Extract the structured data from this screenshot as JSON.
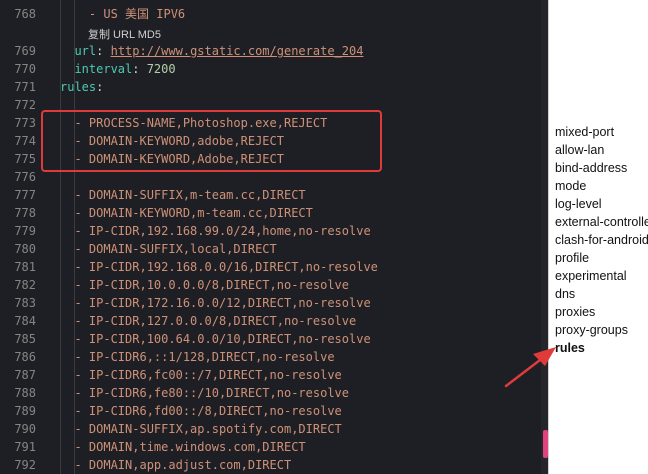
{
  "editor": {
    "tooltip": "复制 URL MD5",
    "lines": [
      {
        "num": "768",
        "indent": "    ",
        "tokens": [
          {
            "t": "- ",
            "c": "s"
          },
          {
            "t": "US 美国 IPV6",
            "c": "s"
          }
        ]
      },
      {
        "num": "",
        "tooltip": true
      },
      {
        "num": "769",
        "indent": "  ",
        "tokens": [
          {
            "t": "url",
            "c": "k"
          },
          {
            "t": ": ",
            "c": "p"
          },
          {
            "t": "http://www.gstatic.com/generate_204",
            "c": "u"
          }
        ]
      },
      {
        "num": "770",
        "indent": "  ",
        "tokens": [
          {
            "t": "interval",
            "c": "k"
          },
          {
            "t": ": ",
            "c": "p"
          },
          {
            "t": "7200",
            "c": "n"
          }
        ]
      },
      {
        "num": "771",
        "indent": "",
        "tokens": [
          {
            "t": "rules",
            "c": "k"
          },
          {
            "t": ":",
            "c": "p"
          }
        ]
      },
      {
        "num": "772",
        "indent": "",
        "tokens": []
      },
      {
        "num": "773",
        "indent": "  ",
        "tokens": [
          {
            "t": "- PROCESS-NAME,Photoshop.exe,REJECT",
            "c": "s"
          }
        ]
      },
      {
        "num": "774",
        "indent": "  ",
        "tokens": [
          {
            "t": "- DOMAIN-KEYWORD,adobe,REJECT",
            "c": "s"
          }
        ]
      },
      {
        "num": "775",
        "indent": "  ",
        "tokens": [
          {
            "t": "- DOMAIN-KEYWORD,Adobe,REJECT",
            "c": "s"
          }
        ]
      },
      {
        "num": "776",
        "indent": "",
        "tokens": []
      },
      {
        "num": "777",
        "indent": "  ",
        "tokens": [
          {
            "t": "- DOMAIN-SUFFIX,m-team.cc,DIRECT",
            "c": "s"
          }
        ]
      },
      {
        "num": "778",
        "indent": "  ",
        "tokens": [
          {
            "t": "- DOMAIN-KEYWORD,m-team.cc,DIRECT",
            "c": "s"
          }
        ]
      },
      {
        "num": "779",
        "indent": "  ",
        "tokens": [
          {
            "t": "- IP-CIDR,192.168.99.0/24,home,no-resolve",
            "c": "s"
          }
        ]
      },
      {
        "num": "780",
        "indent": "  ",
        "tokens": [
          {
            "t": "- DOMAIN-SUFFIX,local,DIRECT",
            "c": "s"
          }
        ]
      },
      {
        "num": "781",
        "indent": "  ",
        "tokens": [
          {
            "t": "- IP-CIDR,192.168.0.0/16,DIRECT,no-resolve",
            "c": "s"
          }
        ]
      },
      {
        "num": "782",
        "indent": "  ",
        "tokens": [
          {
            "t": "- IP-CIDR,10.0.0.0/8,DIRECT,no-resolve",
            "c": "s"
          }
        ]
      },
      {
        "num": "783",
        "indent": "  ",
        "tokens": [
          {
            "t": "- IP-CIDR,172.16.0.0/12,DIRECT,no-resolve",
            "c": "s"
          }
        ]
      },
      {
        "num": "784",
        "indent": "  ",
        "tokens": [
          {
            "t": "- IP-CIDR,127.0.0.0/8,DIRECT,no-resolve",
            "c": "s"
          }
        ]
      },
      {
        "num": "785",
        "indent": "  ",
        "tokens": [
          {
            "t": "- IP-CIDR,100.64.0.0/10,DIRECT,no-resolve",
            "c": "s"
          }
        ]
      },
      {
        "num": "786",
        "indent": "  ",
        "tokens": [
          {
            "t": "- IP-CIDR6,::1/128,DIRECT,no-resolve",
            "c": "s"
          }
        ]
      },
      {
        "num": "787",
        "indent": "  ",
        "tokens": [
          {
            "t": "- IP-CIDR6,fc00::/7,DIRECT,no-resolve",
            "c": "s"
          }
        ]
      },
      {
        "num": "788",
        "indent": "  ",
        "tokens": [
          {
            "t": "- IP-CIDR6,fe80::/10,DIRECT,no-resolve",
            "c": "s"
          }
        ]
      },
      {
        "num": "789",
        "indent": "  ",
        "tokens": [
          {
            "t": "- IP-CIDR6,fd00::/8,DIRECT,no-resolve",
            "c": "s"
          }
        ]
      },
      {
        "num": "790",
        "indent": "  ",
        "tokens": [
          {
            "t": "- DOMAIN-SUFFIX,ap.spotify.com,DIRECT",
            "c": "s"
          }
        ]
      },
      {
        "num": "791",
        "indent": "  ",
        "tokens": [
          {
            "t": "- DOMAIN,time.windows.com,DIRECT",
            "c": "s"
          }
        ]
      },
      {
        "num": "792",
        "indent": "  ",
        "tokens": [
          {
            "t": "- DOMAIN,app.adjust.com,DIRECT",
            "c": "s"
          }
        ]
      }
    ]
  },
  "outline": {
    "items": [
      {
        "label": "mixed-port",
        "active": false
      },
      {
        "label": "allow-lan",
        "active": false
      },
      {
        "label": "bind-address",
        "active": false
      },
      {
        "label": "mode",
        "active": false
      },
      {
        "label": "log-level",
        "active": false
      },
      {
        "label": "external-controller",
        "active": false
      },
      {
        "label": "clash-for-android",
        "active": false
      },
      {
        "label": "profile",
        "active": false
      },
      {
        "label": "experimental",
        "active": false
      },
      {
        "label": "dns",
        "active": false
      },
      {
        "label": "proxies",
        "active": false
      },
      {
        "label": "proxy-groups",
        "active": false
      },
      {
        "label": "rules",
        "active": true
      }
    ]
  },
  "colors": {
    "highlight": "#e03b3b",
    "scroll_thumb": "#e0427d"
  }
}
